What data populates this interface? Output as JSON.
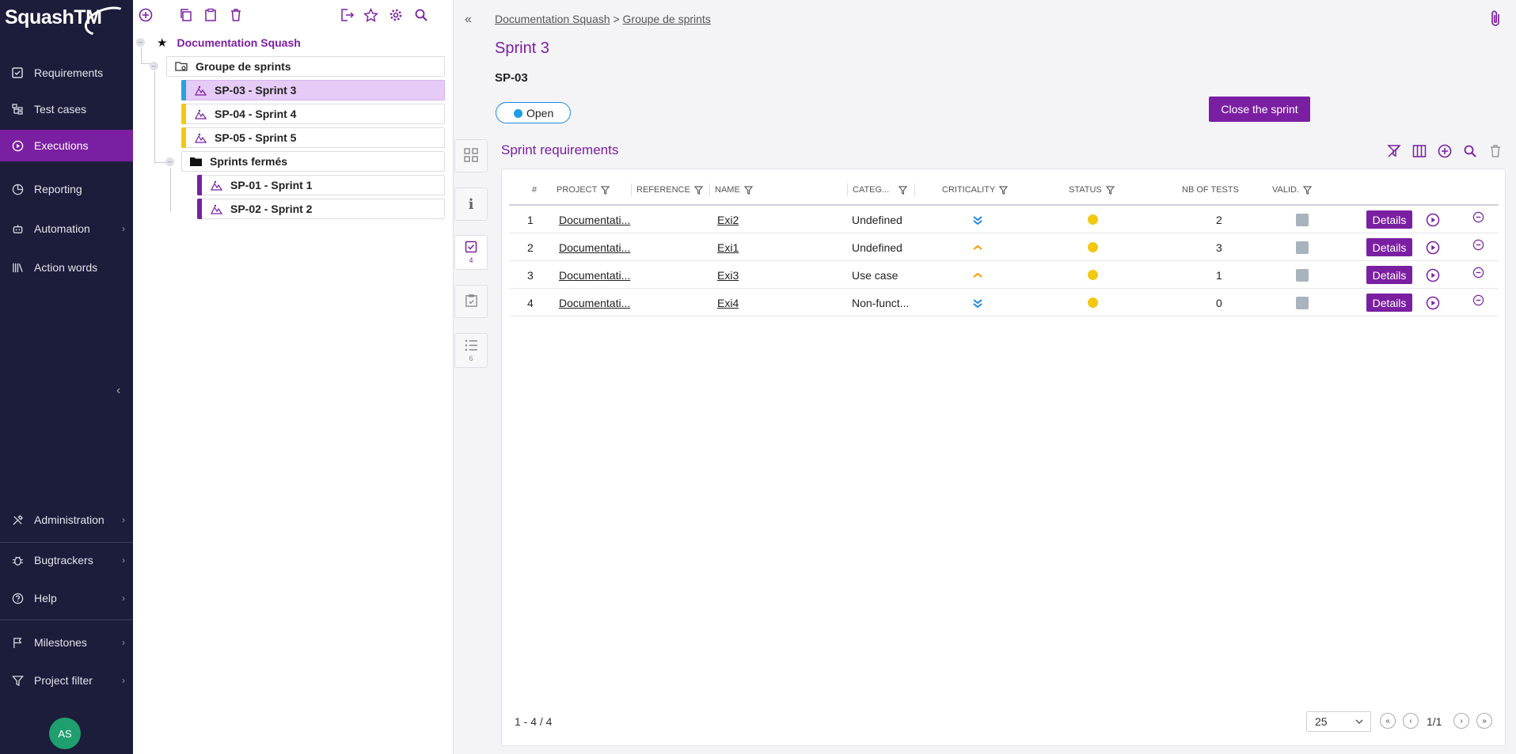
{
  "app": {
    "logo_text": "SquashTM"
  },
  "nav": {
    "items": [
      {
        "label": "Requirements",
        "icon": "checkbox-icon"
      },
      {
        "label": "Test cases",
        "icon": "tree-icon"
      },
      {
        "label": "Executions",
        "icon": "play-circle-icon",
        "active": true
      },
      {
        "label": "Reporting",
        "icon": "pie-chart-icon"
      },
      {
        "label": "Automation",
        "icon": "robot-icon"
      },
      {
        "label": "Action words",
        "icon": "library-icon"
      }
    ],
    "bottom": [
      {
        "label": "Administration",
        "icon": "tools-icon"
      },
      {
        "label": "Bugtrackers",
        "icon": "bug-icon"
      },
      {
        "label": "Help",
        "icon": "help-icon"
      },
      {
        "label": "Milestones",
        "icon": "flag-icon"
      },
      {
        "label": "Project filter",
        "icon": "filter-icon"
      }
    ],
    "avatar": "AS"
  },
  "tree": {
    "project": "Documentation Squash",
    "folder": "Groupe de sprints",
    "folder_sprints": [
      {
        "label": "SP-03 - Sprint 3",
        "color": "#29a3e0",
        "selected": true
      },
      {
        "label": "SP-04 - Sprint 4",
        "color": "#f2c811"
      },
      {
        "label": "SP-05 - Sprint 5",
        "color": "#f2c811"
      }
    ],
    "closed_folder": "Sprints fermés",
    "closed_sprints": [
      {
        "label": "SP-01 - Sprint 1",
        "color": "#7b1fa2"
      },
      {
        "label": "SP-02 - Sprint 2",
        "color": "#7b1fa2"
      }
    ]
  },
  "side_tabs": {
    "requirements_count": "4",
    "list_count": "6"
  },
  "header": {
    "breadcrumb_project": "Documentation Squash",
    "breadcrumb_sep": ">",
    "breadcrumb_folder": "Groupe de sprints",
    "title": "Sprint 3",
    "reference": "SP-03",
    "status": "Open",
    "close_button": "Close the sprint"
  },
  "section": {
    "title": "Sprint requirements"
  },
  "table": {
    "columns": [
      "#",
      "PROJECT",
      "REFERENCE",
      "NAME",
      "CATEG...",
      "CRITICALITY",
      "STATUS",
      "NB OF TESTS",
      "VALID."
    ],
    "rows": [
      {
        "num": "1",
        "project": "Documentati...",
        "reference": "",
        "name": "Exi2",
        "category": "Undefined",
        "criticality": "minor",
        "nb_tests": "2",
        "details": "Details"
      },
      {
        "num": "2",
        "project": "Documentati...",
        "reference": "",
        "name": "Exi1",
        "category": "Undefined",
        "criticality": "major",
        "nb_tests": "3",
        "details": "Details"
      },
      {
        "num": "3",
        "project": "Documentati...",
        "reference": "",
        "name": "Exi3",
        "category": "Use case",
        "criticality": "major",
        "nb_tests": "1",
        "details": "Details"
      },
      {
        "num": "4",
        "project": "Documentati...",
        "reference": "",
        "name": "Exi4",
        "category": "Non-funct...",
        "criticality": "minor",
        "nb_tests": "0",
        "details": "Details"
      }
    ]
  },
  "pager": {
    "count": "1 - 4 / 4",
    "page_size": "25",
    "page": "1/1"
  },
  "colors": {
    "accent": "#7b1fa2",
    "nav_bg": "#1b1d3a",
    "status_yellow": "#f2c811",
    "criticality_minor": "#1e88e5",
    "criticality_major": "#ff9800"
  }
}
